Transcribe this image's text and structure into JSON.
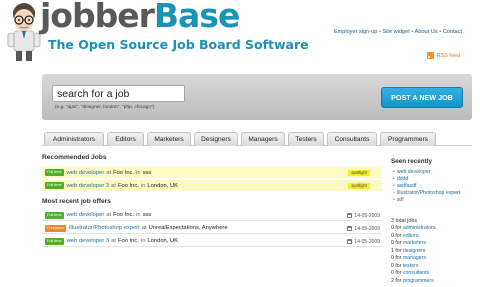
{
  "header": {
    "logo_prefix": "jobber",
    "logo_suffix": "Base",
    "tagline": "The Open Source Job Board Software",
    "links": [
      "Employer sign-up",
      "Site widget",
      "About Us",
      "Contact"
    ],
    "link_separator": "•",
    "rss_label": "RSS feed"
  },
  "search": {
    "value": "search for a job",
    "hint": "(e.g. \"ajax\", \"designer, london\", \"php, chicago\")",
    "post_button": "POST A NEW JOB"
  },
  "tabs": [
    "Administrators",
    "Editors",
    "Marketers",
    "Designers",
    "Managers",
    "Testers",
    "Consultants",
    "Programmers"
  ],
  "recommended": {
    "title": "Recommended Jobs",
    "jobs": [
      {
        "badge": "Full-time",
        "title": "web developer",
        "at": "at",
        "company": "Foo Inc.",
        "in": "in",
        "location": "sss",
        "tag": "spotlight"
      },
      {
        "badge": "Full-time",
        "title": "web developer 3",
        "at": "at",
        "company": "Foo Inc.",
        "in": "in",
        "location": "London, UK",
        "tag": "spotlight"
      }
    ]
  },
  "recent": {
    "title": "Most recent job offers",
    "jobs": [
      {
        "badge": "Full-time",
        "badge_type": "ft",
        "title": "web developer",
        "at": "at",
        "company": "Foo Inc.",
        "in": "in",
        "location": "sss",
        "date": "14-05-2009"
      },
      {
        "badge": "Freelance",
        "badge_type": "fl",
        "title": "Illustrator/Photoshop expert",
        "at": "at",
        "company": "UnrealExpectations, Anywhere",
        "in": "",
        "location": "",
        "date": "14-05-2009"
      },
      {
        "badge": "Full-time",
        "badge_type": "ft",
        "title": "web developer 3",
        "at": "at",
        "company": "Foo Inc.",
        "in": "in",
        "location": "London, UK",
        "date": "14-05-2009"
      }
    ]
  },
  "sidebar": {
    "seen_title": "Seen recently",
    "seen": [
      "web developer",
      "dddd",
      "asdfasdf",
      "Illustrator/Photoshop expert",
      "sdf"
    ],
    "total": "3 total jobs",
    "counts": [
      {
        "n": "0",
        "for": "for",
        "label": "administrators"
      },
      {
        "n": "0",
        "for": "for",
        "label": "editors"
      },
      {
        "n": "0",
        "for": "for",
        "label": "marketers"
      },
      {
        "n": "1",
        "for": "for",
        "label": "designers"
      },
      {
        "n": "0",
        "for": "for",
        "label": "managers"
      },
      {
        "n": "0",
        "for": "for",
        "label": "testers"
      },
      {
        "n": "0",
        "for": "for",
        "label": "consultants"
      },
      {
        "n": "2",
        "for": "for",
        "label": "programmers"
      }
    ]
  },
  "colors": {
    "brand_blue": "#1a93b9",
    "logo_gray": "#595959",
    "spotlight_bg": "#fdfbbf",
    "spotlight_tag": "#f4ef2a",
    "fulltime_badge": "#4fae2e",
    "freelance_badge": "#e8872b",
    "button_blue": "#1e9fd6"
  },
  "icons": {
    "mascot": "mascot-icon",
    "rss": "rss-icon",
    "calendar": "calendar-icon"
  }
}
